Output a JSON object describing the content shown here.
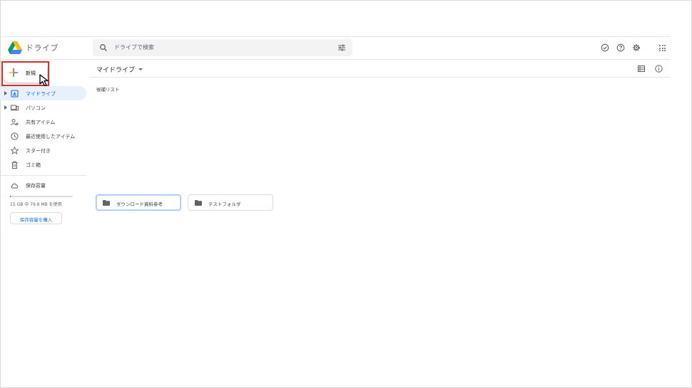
{
  "header": {
    "app_title": "ドライブ",
    "search_placeholder": "ドライブで検索"
  },
  "new_button": {
    "label": "新規"
  },
  "sidebar": {
    "items": [
      {
        "label": "マイドライブ",
        "icon": "my-drive-icon",
        "active": true,
        "expandable": true
      },
      {
        "label": "パソコン",
        "icon": "computers-icon",
        "active": false,
        "expandable": true
      },
      {
        "label": "共有アイテム",
        "icon": "shared-icon",
        "active": false,
        "expandable": false
      },
      {
        "label": "最近使用したアイテム",
        "icon": "recent-clock-icon",
        "active": false,
        "expandable": false
      },
      {
        "label": "スター付き",
        "icon": "star-icon",
        "active": false,
        "expandable": false
      },
      {
        "label": "ゴミ箱",
        "icon": "trash-icon",
        "active": false,
        "expandable": false
      }
    ],
    "storage": {
      "label": "保存容量",
      "usage_text": "15 GB 中 79.8 MB を使用",
      "fraction_used": 0.005,
      "buy_label": "保存容量を購入"
    }
  },
  "main": {
    "title": "マイドライブ",
    "section_label": "候補リスト",
    "folders": [
      {
        "name": "ダウンロード資料参考",
        "selected": true
      },
      {
        "name": "テストフォルダ",
        "selected": false
      }
    ]
  },
  "colors": {
    "accent": "#1a73e8",
    "active_nav_bg": "#e8f0fe",
    "highlight_box": "#d93025"
  }
}
